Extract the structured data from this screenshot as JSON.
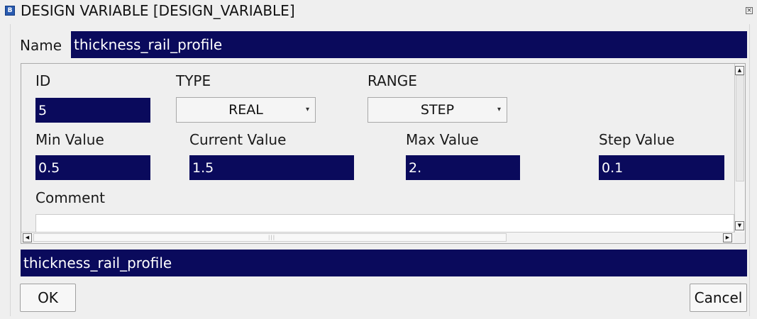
{
  "window": {
    "title": "DESIGN VARIABLE [DESIGN_VARIABLE]",
    "app_icon": "app-logo-icon",
    "close_icon": "close-icon"
  },
  "name": {
    "label": "Name",
    "value": "thickness_rail_profile"
  },
  "panel": {
    "id_label": "ID",
    "id_value": "5",
    "type_label": "TYPE",
    "type_value": "REAL",
    "range_label": "RANGE",
    "range_value": "STEP",
    "min_label": "Min Value",
    "min_value": "0.5",
    "current_label": "Current Value",
    "current_value": "1.5",
    "max_label": "Max Value",
    "max_value": "2.",
    "step_label": "Step Value",
    "step_value": "0.1",
    "comment_label": "Comment",
    "comment_value": ""
  },
  "status": {
    "value": "thickness_rail_profile"
  },
  "buttons": {
    "ok": "OK",
    "cancel": "Cancel"
  },
  "colors": {
    "field_bg": "#0a0a5c",
    "field_text": "#ffffff",
    "window_bg": "#efefef"
  }
}
